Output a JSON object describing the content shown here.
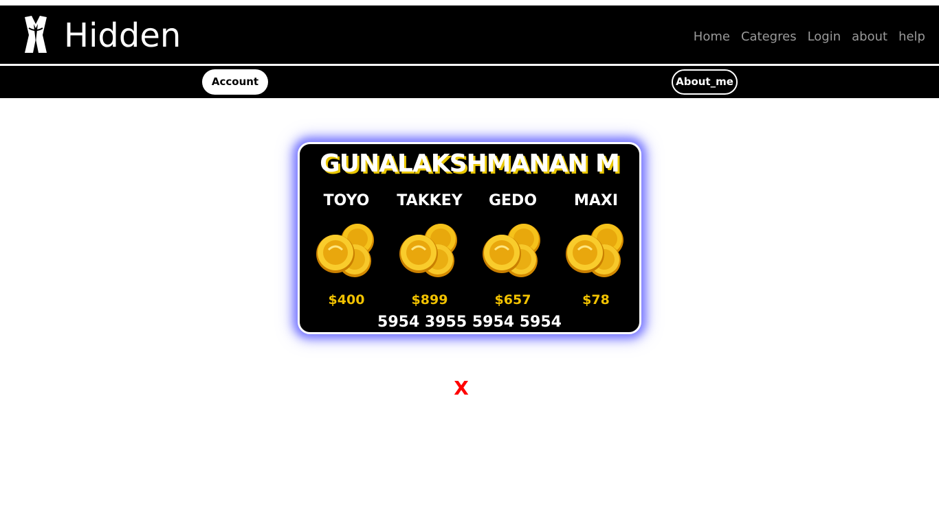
{
  "header": {
    "brand": "Hidden",
    "logo_icon": "tuxedo-mask-icon",
    "nav_links": [
      "Home",
      "Categres",
      "Login",
      "about",
      "help"
    ]
  },
  "subnav": {
    "account_label": "Account",
    "about_label": "About_me"
  },
  "card": {
    "holder_name": "GUNALAKSHMANAN M",
    "columns": [
      {
        "name": "TOYO",
        "icon": "gold-coins-icon",
        "price": "$400"
      },
      {
        "name": "TAKKEY",
        "icon": "gold-coins-icon",
        "price": "$899"
      },
      {
        "name": "GEDO",
        "icon": "gold-coins-icon",
        "price": "$657"
      },
      {
        "name": "MAXI",
        "icon": "gold-coins-icon",
        "price": "$78"
      }
    ],
    "number": "5954 3955 5954 5954"
  },
  "close_label": "X",
  "colors": {
    "navbar": "#000000",
    "price": "#f2c200",
    "card_glow": "#7a7aff",
    "close": "#ff0000"
  }
}
